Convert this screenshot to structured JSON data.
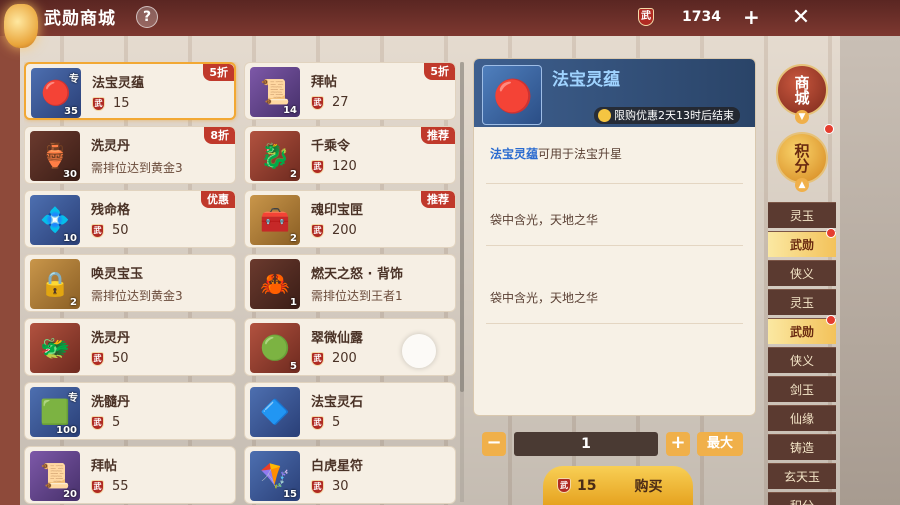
{
  "header": {
    "title": "武勋商城",
    "help": "?",
    "currency_icon": "武",
    "currency_value": "1734",
    "plus": "+",
    "close": "✕"
  },
  "items": [
    {
      "name": "法宝灵蕴",
      "price": "15",
      "count": "35",
      "tag": "专",
      "ribbon": "5折",
      "glyph": "🔴",
      "tone": "blue"
    },
    {
      "name": "拜帖",
      "price": "27",
      "count": "14",
      "tag": "",
      "ribbon": "5折",
      "glyph": "📜",
      "tone": "purple"
    },
    {
      "name": "洗灵丹",
      "req": "需排位达到黄金3",
      "count": "30",
      "tag": "",
      "ribbon": "8折",
      "glyph": "🏺",
      "tone": "dark"
    },
    {
      "name": "千乘令",
      "price": "120",
      "count": "2",
      "tag": "",
      "ribbon": "推荐",
      "glyph": "🐉",
      "tone": "red"
    },
    {
      "name": "残命格",
      "price": "50",
      "count": "10",
      "tag": "",
      "ribbon": "优惠",
      "glyph": "💠",
      "tone": "blue"
    },
    {
      "name": "魂印宝匣",
      "price": "200",
      "count": "2",
      "tag": "",
      "ribbon": "推荐",
      "glyph": "🧰",
      "tone": "gold"
    },
    {
      "name": "唤灵宝玉",
      "req": "需排位达到黄金3",
      "count": "2",
      "tag": "",
      "ribbon": "",
      "glyph": "🔒",
      "tone": "gold"
    },
    {
      "name": "燃天之怒 · 背饰",
      "req": "需排位达到王者1",
      "count": "1",
      "tag": "",
      "ribbon": "",
      "glyph": "🦀",
      "tone": "dark"
    },
    {
      "name": "洗灵丹",
      "price": "50",
      "count": "",
      "tag": "",
      "ribbon": "",
      "glyph": "🐲",
      "tone": "red"
    },
    {
      "name": "翠微仙露",
      "price": "200",
      "count": "5",
      "tag": "",
      "ribbon": "",
      "glyph": "🟢",
      "tone": "red"
    },
    {
      "name": "洗髓丹",
      "price": "5",
      "count": "100",
      "tag": "专",
      "ribbon": "",
      "glyph": "🟩",
      "tone": "blue"
    },
    {
      "name": "法宝灵石",
      "price": "5",
      "count": "",
      "tag": "",
      "ribbon": "",
      "glyph": "🔷",
      "tone": "blue"
    },
    {
      "name": "拜帖",
      "price": "55",
      "count": "20",
      "tag": "",
      "ribbon": "",
      "glyph": "📜",
      "tone": "purple"
    },
    {
      "name": "白虎星符",
      "price": "30",
      "count": "15",
      "tag": "",
      "ribbon": "",
      "glyph": "🪁",
      "tone": "blue"
    }
  ],
  "detail": {
    "title": "法宝灵蕴",
    "limited": "限购优惠2天13时后结束",
    "desc_highlight": "法宝灵蕴",
    "desc_rest": "可用于法宝升星",
    "flavor1": "袋中含光，天地之华",
    "flavor2": "袋中含光，天地之华"
  },
  "purchase": {
    "minus": "−",
    "quantity": "1",
    "plus": "+",
    "max": "最大",
    "price": "15",
    "buy": "购买"
  },
  "nav": {
    "shop": "商城",
    "points": "积分",
    "sub": [
      "灵玉",
      "武勋",
      "侠义",
      "灵玉",
      "武勋",
      "侠义",
      "剑玉",
      "仙缘",
      "铸造",
      "玄天玉",
      "积分"
    ]
  }
}
